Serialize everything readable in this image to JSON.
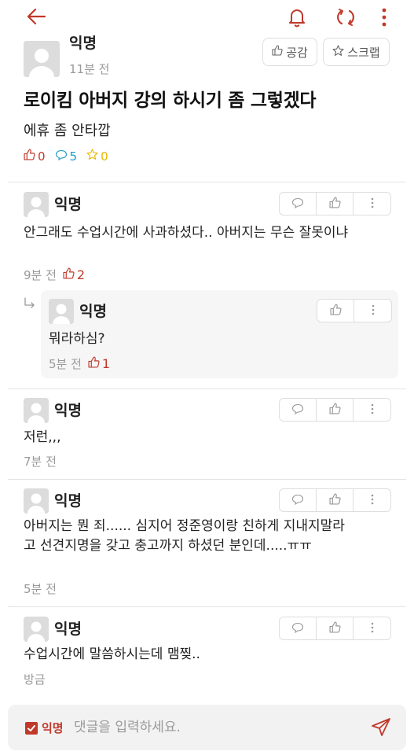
{
  "post": {
    "author": "익명",
    "time": "11분 전",
    "empathize_label": "공감",
    "scrap_label": "스크랩",
    "title": "로이킴 아버지 강의 하시기 좀 그렇겠다",
    "body": "에휴 좀 안타깝",
    "likes": "0",
    "comments": "5",
    "scraps": "0"
  },
  "comments": [
    {
      "author": "익명",
      "text": "안그래도 수업시간에 사과하셨다.. 아버지는 무슨 잘못이냐",
      "time": "9분 전",
      "likes": "2"
    },
    {
      "author": "익명",
      "text": "저런,,,",
      "time": "7분 전"
    },
    {
      "author": "익명",
      "text": "아버지는 뭔 죄...... 심지어 정준영이랑 친하게 지내지말라고 선견지명을 갖고 충고까지 하셨던 분인데.....ㅠㅠ",
      "time": "5분 전"
    },
    {
      "author": "익명",
      "text": "수업시간에 말씀하시는데 맴찢..",
      "time": "방금"
    }
  ],
  "reply": {
    "author": "익명",
    "text": "뭐라하심?",
    "time": "5분 전",
    "likes": "1"
  },
  "composer": {
    "anon_label": "익명",
    "placeholder": "댓글을 입력하세요."
  },
  "colors": {
    "accent": "#c0392b",
    "comment_blue": "#1a9bc9",
    "scrap_yellow": "#e6b800"
  }
}
